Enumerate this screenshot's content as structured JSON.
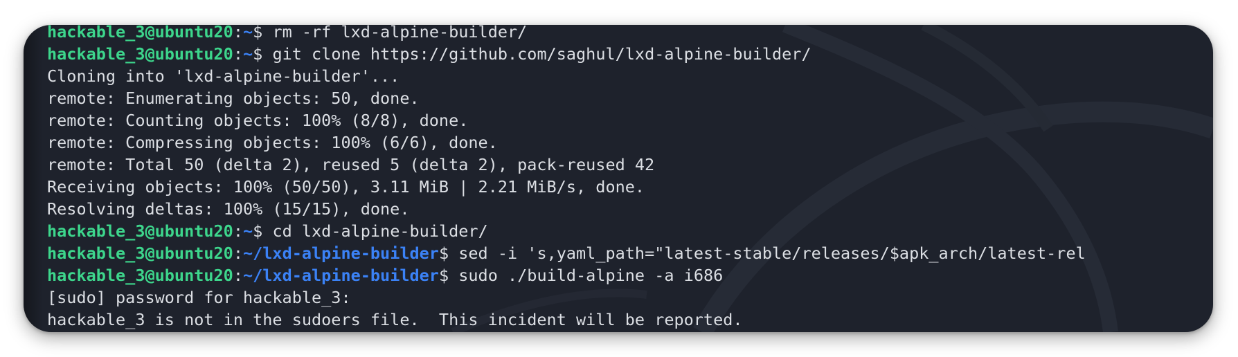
{
  "terminal": {
    "lines": [
      {
        "type": "prompt",
        "user": "hackable_3@ubuntu20",
        "path": "~",
        "cmd": " rm -rf lxd-alpine-builder/"
      },
      {
        "type": "prompt",
        "user": "hackable_3@ubuntu20",
        "path": "~",
        "cmd": " git clone https://github.com/saghul/lxd-alpine-builder/"
      },
      {
        "type": "output",
        "text": "Cloning into 'lxd-alpine-builder'..."
      },
      {
        "type": "output",
        "text": "remote: Enumerating objects: 50, done."
      },
      {
        "type": "output",
        "text": "remote: Counting objects: 100% (8/8), done."
      },
      {
        "type": "output",
        "text": "remote: Compressing objects: 100% (6/6), done."
      },
      {
        "type": "output",
        "text": "remote: Total 50 (delta 2), reused 5 (delta 2), pack-reused 42"
      },
      {
        "type": "output",
        "text": "Receiving objects: 100% (50/50), 3.11 MiB | 2.21 MiB/s, done."
      },
      {
        "type": "output",
        "text": "Resolving deltas: 100% (15/15), done."
      },
      {
        "type": "prompt",
        "user": "hackable_3@ubuntu20",
        "path": "~",
        "cmd": " cd lxd-alpine-builder/"
      },
      {
        "type": "prompt",
        "user": "hackable_3@ubuntu20",
        "path": "~/lxd-alpine-builder",
        "cmd": " sed -i 's,yaml_path=\"latest-stable/releases/$apk_arch/latest-rel"
      },
      {
        "type": "prompt",
        "user": "hackable_3@ubuntu20",
        "path": "~/lxd-alpine-builder",
        "cmd": " sudo ./build-alpine -a i686"
      },
      {
        "type": "output",
        "text": "[sudo] password for hackable_3:"
      },
      {
        "type": "output",
        "text": "hackable_3 is not in the sudoers file.  This incident will be reported."
      }
    ]
  },
  "colors": {
    "background": "#1e222c",
    "user": "#3dd68c",
    "path": "#3b82f6",
    "text": "#dcdfe4"
  }
}
